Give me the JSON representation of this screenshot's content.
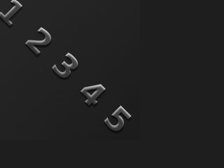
{
  "digits": [
    "1",
    "2",
    "3",
    "4",
    "5"
  ],
  "colors": {
    "background": "#222222",
    "digit_fill": "#b9b9b9"
  }
}
